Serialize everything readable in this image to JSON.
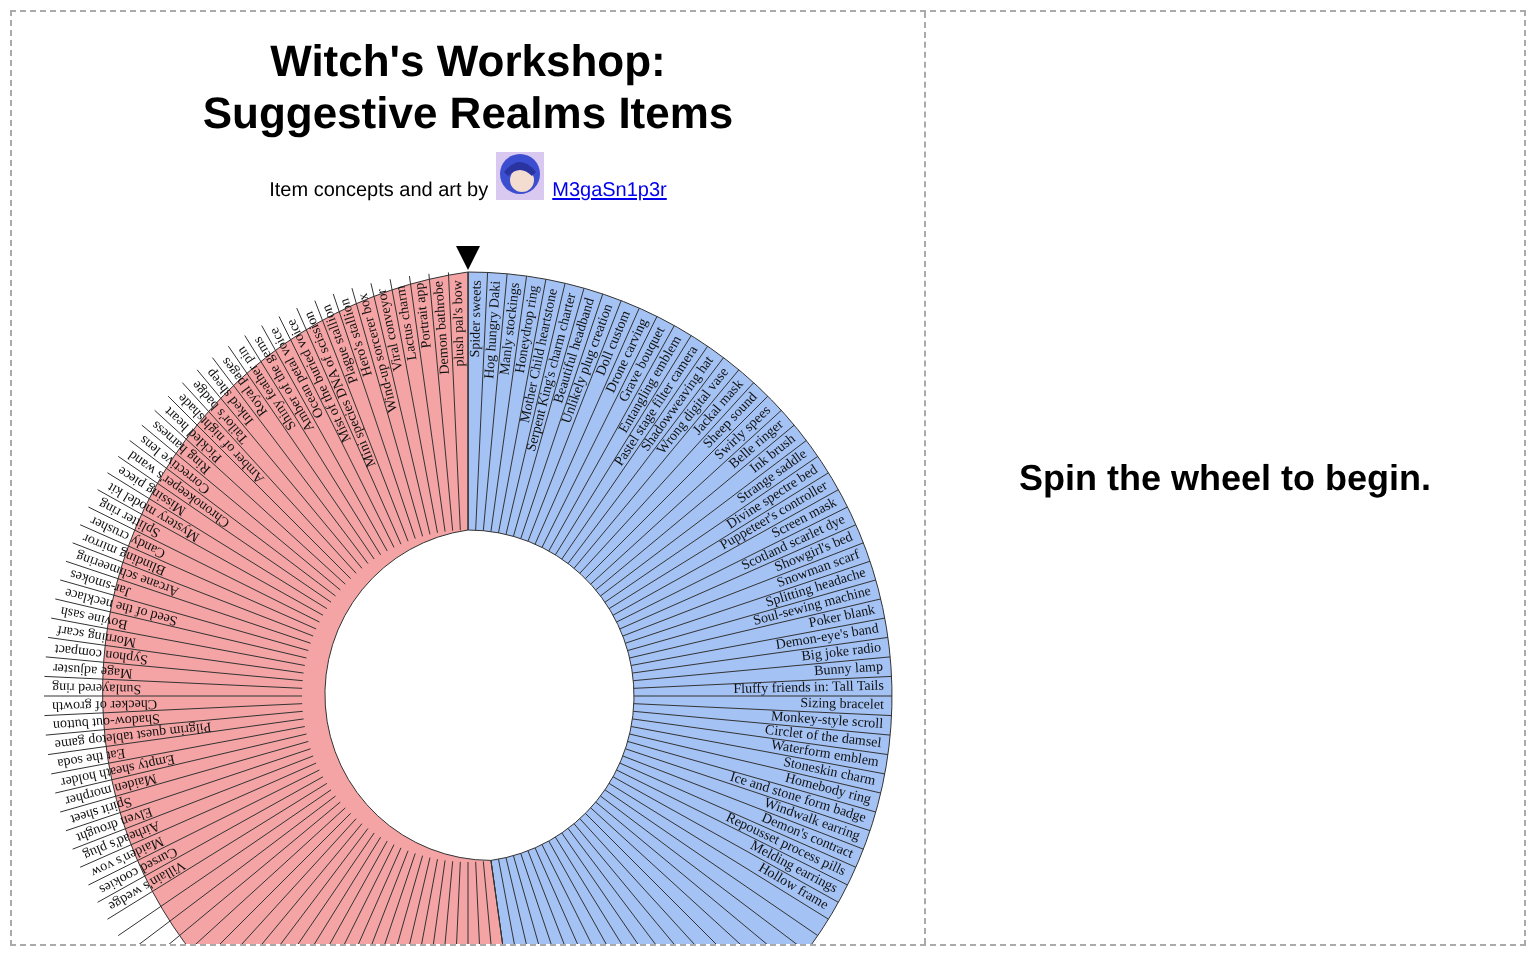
{
  "title": [
    "Witch's Workshop:",
    "Suggestive Realms Items"
  ],
  "credit": {
    "text": "Item concepts and art by",
    "author": "M3gaSn1p3r"
  },
  "wheel": {
    "sections": [
      {
        "color": "#a4c2f4",
        "labels": [
          "Spider sweets",
          "Hog hungry Daki",
          "Manly stockings",
          "Honeydrop ring",
          "Mother Child heartstone",
          "Serpent King's charm charter",
          "Beautiful headband",
          "Unlikely plug creation",
          "Doll custom",
          "Drone carving",
          "Grave bouquet",
          "Entangling emblem",
          "Pastel stage filter camera",
          "Shadowweaving hat",
          "Wrong digital vase",
          "Jackal mask",
          "Sheep sound",
          "Swirly spees",
          "Belle ringer",
          "Ink brush",
          "Strange saddle",
          "Divine spectre bed",
          "Puppeteer's controller",
          "Screen mask",
          "Scotland scarlet dye",
          "Showgirl's bed",
          "Snowman scarf",
          "Splitting headache",
          "Soul-sewing machine",
          "Poker blank",
          "Demon-eye's band",
          "Big joke radio",
          "Bunny lamp",
          "Fluffy friends in: Tall Tails",
          "Sizing bracelet",
          "Monkey-style scroll",
          "Circlet of the damsel",
          "Waterform emblem",
          "Stoneskin charm",
          "Homebody ring",
          "Ice and stone form badge",
          "Windwalk earring",
          "Demon's contract",
          "Repousset process pills",
          "Melding earrings",
          "Hollow frame"
        ]
      },
      {
        "color": "#f4a4a4",
        "labels": [
          "plush pal's bow",
          "Demon bathrobe",
          "Portrait app",
          "Lactus charm",
          "Viral conveyor",
          "Wind-up sorcerer box",
          "Hero's stallion",
          "Plague stallion",
          "Mini species DNA of scission",
          "Mist of the buried voice",
          "Ocean petal voice",
          "Amber of the gems",
          "Shiny feather pin",
          "Royal pages",
          "Inked sheep",
          "Tailor's badge",
          "Amber of nightshade",
          "Pickled heart",
          "Ring harness",
          "Corrective lens",
          "Chronokeeper's wand",
          "Missing piece",
          "Mystery model kit",
          "Splitter ring",
          "Candy crusher",
          "Blinding mirror",
          "Arcane schmeering",
          "Jar-smokes",
          "Seed of the necklace",
          "Bovine sash",
          "Morning scarf",
          "Syphon compact",
          "Mage adjuster",
          "Sunlayered ring",
          "Checker of growth",
          "Shadow-out button",
          "Pilgrim quest tabletop game",
          "Eat the soda",
          "Empty sheath holder",
          "Maiden morpher",
          "Spirit sheet",
          "Elven drought",
          "Airhead's plug",
          "Maiden's vow",
          "Cursed cookies",
          "Villain's wedge"
        ]
      }
    ]
  },
  "result": "Spin the wheel to begin."
}
